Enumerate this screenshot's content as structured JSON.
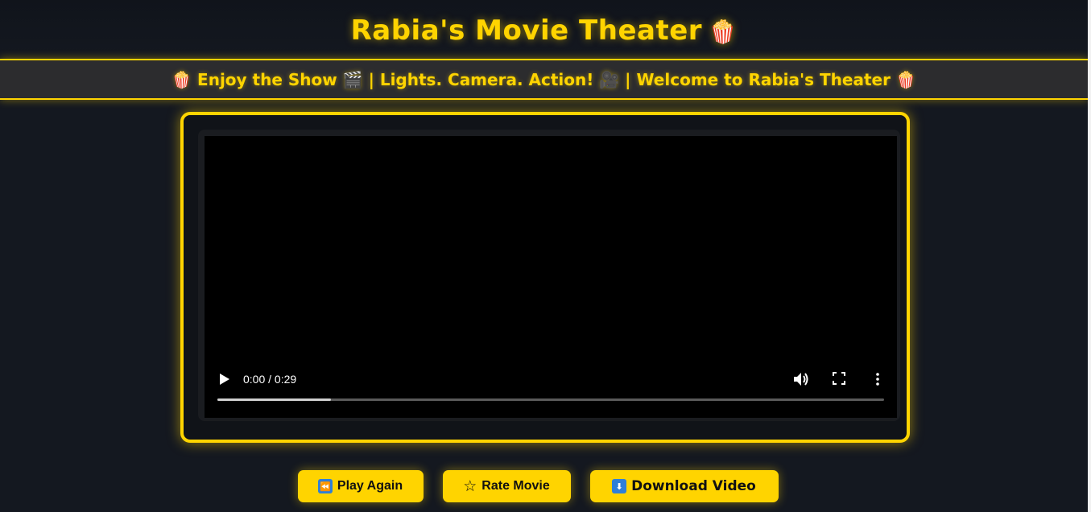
{
  "header": {
    "title": "Rabia's Movie Theater",
    "title_emoji": "🍿"
  },
  "marquee": {
    "text": "🍿 Enjoy the Show 🎬 | Lights. Camera. Action! 🎥 | Welcome to Rabia's Theater 🍿"
  },
  "player": {
    "time": "0:00 / 0:29",
    "progress_fraction": 0.17,
    "icons": [
      "play-icon",
      "volume-icon",
      "fullscreen-icon",
      "more-options-icon"
    ]
  },
  "actions": {
    "play_again": {
      "icon": "⏪",
      "label": "Play Again"
    },
    "rate": {
      "icon": "☆",
      "label": "Rate Movie"
    },
    "download": {
      "icon": "⬇",
      "label": "Download Video"
    }
  },
  "colors": {
    "accent": "#ffd400",
    "background": "#141820",
    "marquee_bg": "#2c2c2e",
    "video_bg": "#000000"
  }
}
